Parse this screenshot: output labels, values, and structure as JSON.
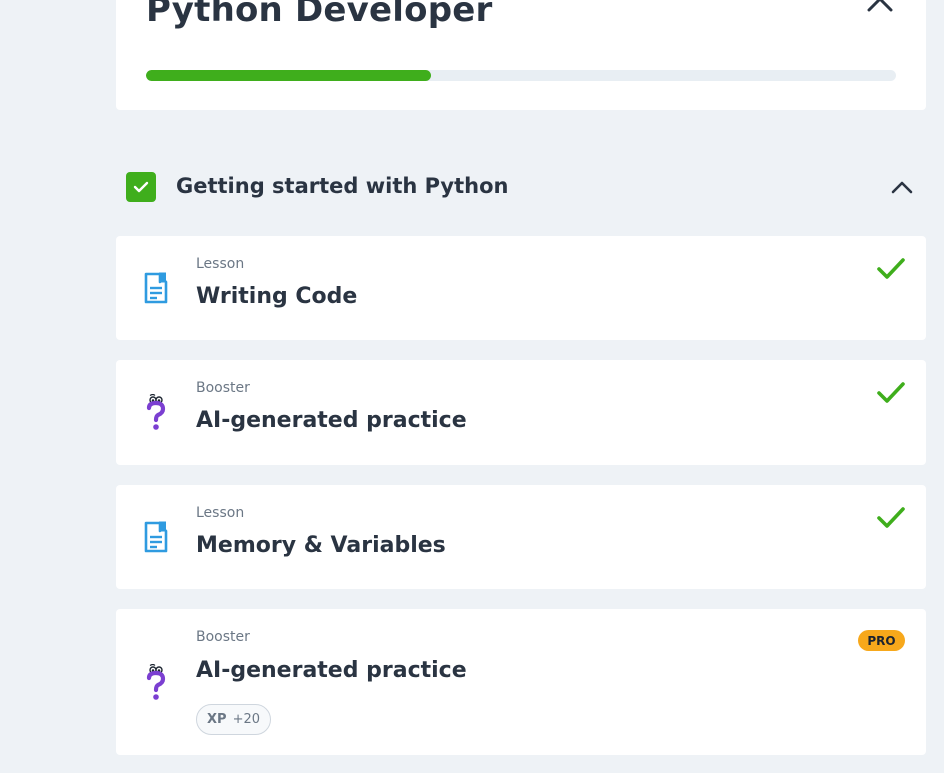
{
  "course": {
    "title": "Python Developer",
    "progress_percent": 38
  },
  "section": {
    "title": "Getting started with Python",
    "completed": true
  },
  "items": [
    {
      "type": "Lesson",
      "title": "Writing Code",
      "icon": "lesson-document-icon",
      "completed": true
    },
    {
      "type": "Booster",
      "title": "AI-generated practice",
      "icon": "question-mark-mascot-icon",
      "completed": true
    },
    {
      "type": "Lesson",
      "title": "Memory & Variables",
      "icon": "lesson-document-icon",
      "completed": true
    },
    {
      "type": "Booster",
      "title": "AI-generated practice",
      "icon": "question-mark-mascot-icon",
      "completed": false,
      "badge": "PRO",
      "xp_label": "XP",
      "xp_value": "+20"
    }
  ],
  "colors": {
    "accent_green": "#3fae1c",
    "pro_badge": "#f7a81b",
    "lesson_icon": "#2f9be0",
    "booster_icon": "#7b3fd1"
  }
}
